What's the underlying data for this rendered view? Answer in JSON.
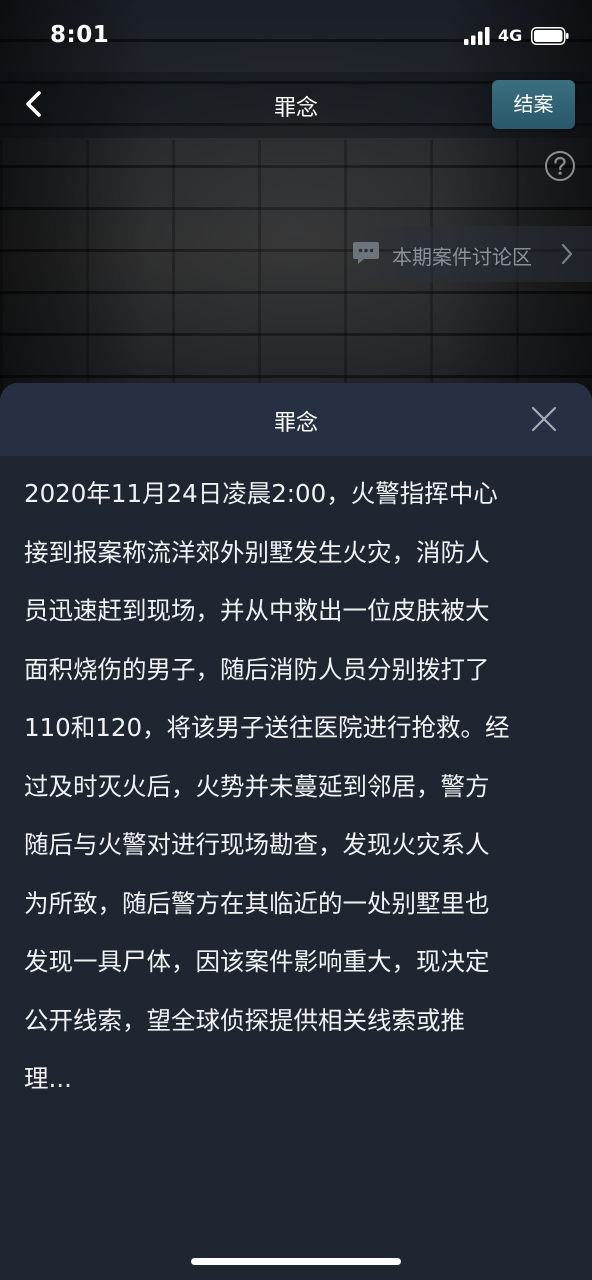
{
  "status_bar": {
    "time": "8:01",
    "network": "4G",
    "icons": [
      "signal-icon",
      "battery-icon"
    ]
  },
  "nav": {
    "title": "罪念",
    "back_icon": "chevron-left-icon",
    "action_label": "结案"
  },
  "help": {
    "icon": "question-circle-icon"
  },
  "discussion": {
    "label": "本期案件讨论区",
    "icon": "chat-bubble-icon",
    "chevron": "chevron-right-icon"
  },
  "sheet": {
    "title": "罪念",
    "close_icon": "close-icon",
    "lines": [
      "2020年11月24日凌晨2:00，火警指挥中心",
      "接到报案称流洋郊外别墅发生火灾，消防人",
      "员迅速赶到现场，并从中救出一位皮肤被大",
      "面积烧伤的男子，随后消防人员分别拨打了",
      "110和120，将该男子送往医院进行抢救。经",
      "过及时灭火后，火势并未蔓延到邻居，警方",
      "随后与火警对进行现场勘查，发现火灾系人",
      "为所致，随后警方在其临近的一处别墅里也",
      "发现一具尸体，因该案件影响重大，现决定",
      "公开线索，望全球侦探提供相关线索或推",
      "理..."
    ]
  },
  "colors": {
    "accent": "#2f6476",
    "sheet_bg": "#1f2632",
    "sheet_header_bg": "#263042",
    "text": "#f1f2f4"
  }
}
